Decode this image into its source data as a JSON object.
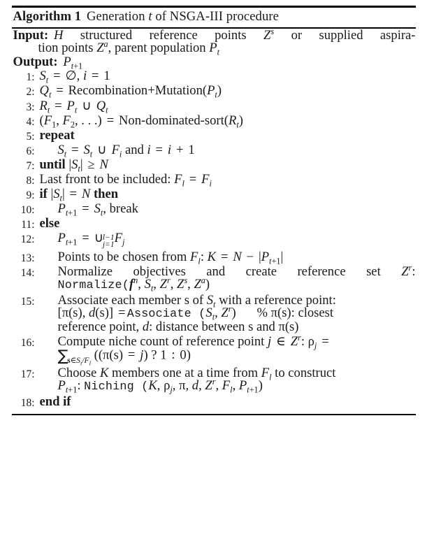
{
  "algorithm": {
    "title": {
      "label": "Algorithm 1",
      "caption": "Generation t of NSGA-III procedure",
      "caption_parts": [
        "Generation ",
        "t",
        " of NSGA-III procedure"
      ]
    },
    "io": {
      "input_label": "Input:",
      "input_text_line1": "H structured reference points Z^s or supplied aspira-",
      "input_text_line2": "tion points Z^a, parent population P_t",
      "output_label": "Output:",
      "output_text": "P_{t+1}"
    },
    "steps": [
      {
        "num": "1:",
        "indent": 1,
        "text": "S_t = ∅, i = 1"
      },
      {
        "num": "2:",
        "indent": 1,
        "text": "Q_t = Recombination+Mutation(P_t)"
      },
      {
        "num": "3:",
        "indent": 1,
        "text": "R_t = P_t ∪ Q_t"
      },
      {
        "num": "4:",
        "indent": 1,
        "text": "(F_1, F_2, ...) = Non-dominated-sort(R_t)"
      },
      {
        "num": "5:",
        "indent": 1,
        "text": "repeat"
      },
      {
        "num": "6:",
        "indent": 2,
        "text": "S_t = S_t ∪ F_i and i = i + 1"
      },
      {
        "num": "7:",
        "indent": 1,
        "text": "until |S_t| ≥ N"
      },
      {
        "num": "8:",
        "indent": 1,
        "text": "Last front to be included: F_l = F_i"
      },
      {
        "num": "9:",
        "indent": 1,
        "text": "if |S_t| = N then"
      },
      {
        "num": "10:",
        "indent": 2,
        "text": "P_{t+1} = S_t, break"
      },
      {
        "num": "11:",
        "indent": 1,
        "text": "else"
      },
      {
        "num": "12:",
        "indent": 2,
        "text": "P_{t+1} = ∪_{j=1}^{l-1} F_j"
      },
      {
        "num": "13:",
        "indent": 2,
        "text": "Points to be chosen from F_l: K = N - |P_{t+1}|"
      },
      {
        "num": "14:",
        "indent": 2,
        "text": "Normalize objectives and create reference set Z^r: Normalize(f^n, S_t, Z^r, Z^s, Z^a)"
      },
      {
        "num": "15:",
        "indent": 2,
        "text": "Associate each member s of S_t with a reference point: [π(s), d(s)] =Associate(S_t, Z^r)   % π(s): closest reference point, d: distance between s and π(s)"
      },
      {
        "num": "16:",
        "indent": 2,
        "text": "Compute niche count of reference point j ∈ Z^r: ρ_j = ∑_{s∈S_t/F_l} ((π(s) = j) ? 1 : 0)"
      },
      {
        "num": "17:",
        "indent": 2,
        "text": "Choose K members one at a time from F_l to construct P_{t+1}: Niching(K, ρ_j, π, d, Z^r, F_l, P_{t+1})"
      },
      {
        "num": "18:",
        "indent": 1,
        "text": "end if"
      }
    ],
    "keywords": {
      "repeat": "repeat",
      "until": "until",
      "if": "if",
      "then": "then",
      "else": "else",
      "end_if": "end if",
      "break": "break",
      "and": "and"
    },
    "procedure_calls": [
      "Recombination+Mutation",
      "Non-dominated-sort",
      "Normalize",
      "Associate",
      "Niching"
    ],
    "symbols": {
      "emptyset": "∅",
      "union": "∪",
      "geq": "≥",
      "element_of": "∈",
      "sum": "∑",
      "pi": "π",
      "rho": "ρ",
      "percent": "%"
    },
    "colors": {
      "text": "#1a1a1a",
      "rule": "#000000",
      "background": "#ffffff"
    }
  }
}
